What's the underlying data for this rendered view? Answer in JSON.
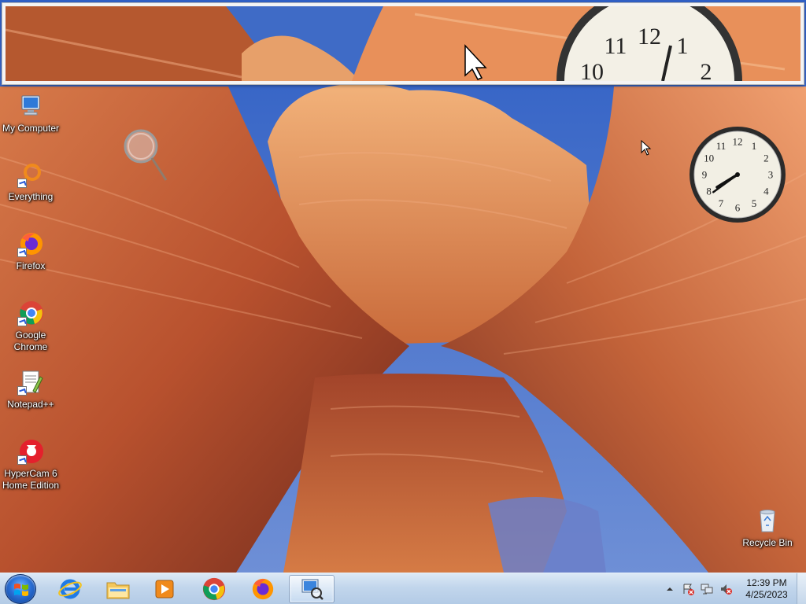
{
  "desktop": {
    "icons": [
      {
        "label": "My Computer"
      },
      {
        "label": "Everything"
      },
      {
        "label": "Firefox"
      },
      {
        "label": "Google Chrome"
      },
      {
        "label": "Notepad++"
      },
      {
        "label": "HyperCam 6 Home Edition"
      },
      {
        "label": "Recycle Bin"
      }
    ]
  },
  "clock_gadget": {
    "numerals": [
      "12",
      "1",
      "2",
      "3",
      "4",
      "5",
      "6",
      "7",
      "8",
      "9",
      "10",
      "11"
    ],
    "magnified_numerals": [
      "10",
      "11",
      "12",
      "1",
      "2"
    ],
    "time": "12:39"
  },
  "taskbar": {
    "pinned": [
      {
        "icon": "internet-explorer-icon"
      },
      {
        "icon": "file-explorer-icon"
      },
      {
        "icon": "media-player-icon"
      },
      {
        "icon": "chrome-icon"
      },
      {
        "icon": "firefox-icon"
      },
      {
        "icon": "magnifier-icon"
      }
    ],
    "tray": {
      "time": "12:39 PM",
      "date": "4/25/2023"
    }
  },
  "colors": {
    "taskbar": "#c2d6ec",
    "sky": "#3f6fc9",
    "rock": "#b4532f"
  }
}
